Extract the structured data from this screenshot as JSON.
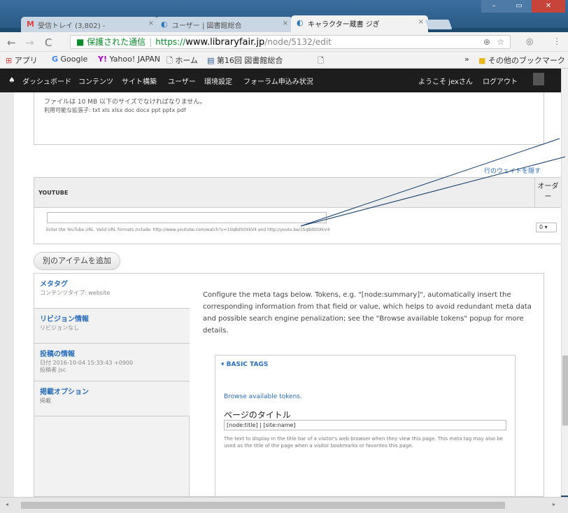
{
  "browser": {
    "tabs": [
      {
        "icon": "M",
        "title": "受信トレイ (3,802) - "
      },
      {
        "icon": "◐",
        "title": "ユーザー | 図書館総合"
      },
      {
        "icon": "◐",
        "title": "キャラクター蔵書 ジぎ"
      }
    ],
    "close_glyph": "×",
    "address": {
      "secure_label": "保護された通信",
      "scheme": "https://",
      "host": "www.libraryfair.jp",
      "path": "/node/5132/edit"
    },
    "bookmarks": [
      {
        "icon": "⊞",
        "label": "アプリ"
      },
      {
        "icon": "G",
        "label": "Google"
      },
      {
        "icon": "Y!",
        "label": "Yahoo! JAPAN"
      },
      {
        "icon": "🗋",
        "label": "ホーム"
      },
      {
        "icon": "▤",
        "label": "第16回 図書館総合 "
      },
      {
        "icon": "🗋",
        "label": ""
      }
    ],
    "bookmarks_more": "»",
    "other_bookmarks": "その他のブックマーク"
  },
  "admin_toolbar": {
    "home_icon": "♠",
    "items": [
      "ダッシュボード",
      "コンテンツ",
      "サイト構築",
      "ユーザー",
      "環境設定",
      "フォーラム申込み状況"
    ],
    "welcome": "ようこそ jexさん",
    "logout": "ログアウト"
  },
  "file_field": {
    "size_note": "ファイルは 10 MB 以下のサイズでなければなりません。",
    "types_note": "利用可能な拡張子: txt xls xlsx doc docx ppt pptx pdf"
  },
  "hide_weights": "行のウェイトを隠す",
  "youtube": {
    "title": "YOUTUBE",
    "order_header": "オーダー",
    "input_value": "",
    "help": "Enter the YouTube URL. Valid URL formats include: http://www.youtube.com/watch?v=1SqBdS0XkV4 and http://youtu.be/1SqBdS0XkV4",
    "weight": "0"
  },
  "add_more": "別のアイテムを追加",
  "vertical_tabs": [
    {
      "title": "メタタグ",
      "summary": "コンテンツタイプ: website"
    },
    {
      "title": "リビジョン情報",
      "summary": "リビジョンなし"
    },
    {
      "title": "投稿の情報",
      "summary": "日付 2016-10-04 15:33:43 +0900\n投稿者 jsc"
    },
    {
      "title": "掲載オプション",
      "summary": "掲載"
    }
  ],
  "metatags": {
    "description": "Configure the meta tags below. Tokens, e.g. \"[node:summary]\", automatically insert the corresponding information from that field or value, which helps to avoid redundant meta data and possible search engine penalization; see the \"Browse available tokens\" popup for more details.",
    "basic_legend": "▾ BASIC TAGS",
    "browse_tokens": "Browse available tokens.",
    "page_title_label": "ページのタイトル",
    "page_title_value": "[node:title] | [site:name]",
    "page_title_help": "The text to display in the title bar of a visitor's web browser when they view this page. This meta tag may also be used as the title of the page when a visitor bookmarks or favorites this page."
  },
  "colors": {
    "link": "#2a6ebb",
    "admin_bar": "#1d1d1d",
    "secure": "#0a8a2a"
  }
}
